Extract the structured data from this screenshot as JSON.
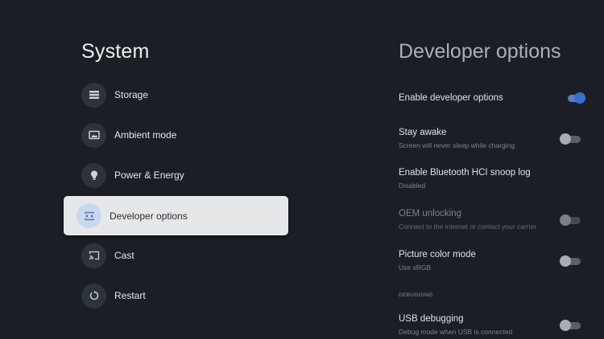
{
  "left": {
    "title": "System",
    "items": [
      {
        "label": "Storage"
      },
      {
        "label": "Ambient mode"
      },
      {
        "label": "Power & Energy"
      },
      {
        "label": "Developer options"
      },
      {
        "label": "Cast"
      },
      {
        "label": "Restart"
      }
    ]
  },
  "right": {
    "title": "Developer options",
    "settings": [
      {
        "title": "Enable developer options",
        "subtitle": "",
        "on": true
      },
      {
        "title": "Stay awake",
        "subtitle": "Screen will never sleep while charging",
        "on": false
      },
      {
        "title": "Enable Bluetooth HCI snoop log",
        "subtitle": "Disabled"
      },
      {
        "title": "OEM unlocking",
        "subtitle": "Connect to the internet or contact your carrier",
        "on": false
      },
      {
        "title": "Picture color mode",
        "subtitle": "Use sRGB",
        "on": false
      },
      {
        "title": "USB debugging",
        "subtitle": "Debug mode when USB is connected",
        "on": false
      }
    ],
    "section_debugging": "DEBUGGING"
  },
  "colors": {
    "background": "#1b1f25",
    "selected_bg": "#e6e7e9",
    "accent": "#3b6ed0"
  }
}
